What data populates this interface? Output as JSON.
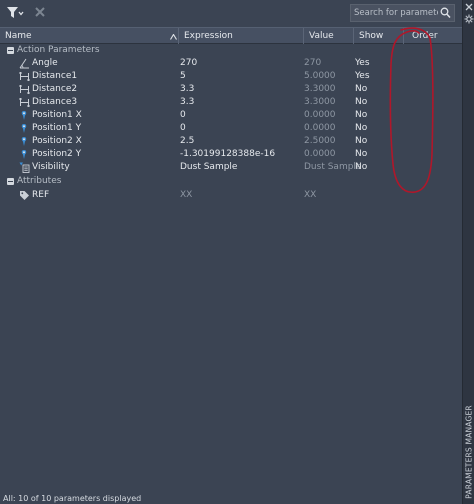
{
  "toolbar": {
    "filter_icon": "filter-icon",
    "clear_icon": "clear-filter-icon",
    "search_placeholder": "Search for parameter"
  },
  "columns": {
    "name": "Name",
    "expression": "Expression",
    "value": "Value",
    "show": "Show",
    "order": "Order"
  },
  "groups": {
    "action": {
      "label": "Action Parameters",
      "expanded": true
    },
    "attributes": {
      "label": "Attributes",
      "expanded": true
    }
  },
  "parameters": [
    {
      "name": "Angle",
      "icon": "angle-icon",
      "expression": "270",
      "value": "270",
      "show": "Yes"
    },
    {
      "name": "Distance1",
      "icon": "distance-icon",
      "expression": "5",
      "value": "5.0000",
      "show": "Yes"
    },
    {
      "name": "Distance2",
      "icon": "distance-icon",
      "expression": "3.3",
      "value": "3.3000",
      "show": "No"
    },
    {
      "name": "Distance3",
      "icon": "distance-icon",
      "expression": "3.3",
      "value": "3.3000",
      "show": "No"
    },
    {
      "name": "Position1 X",
      "icon": "position-icon",
      "expression": "0",
      "value": "0.0000",
      "show": "No"
    },
    {
      "name": "Position1 Y",
      "icon": "position-icon",
      "expression": "0",
      "value": "0.0000",
      "show": "No"
    },
    {
      "name": "Position2 X",
      "icon": "position-icon",
      "expression": "2.5",
      "value": "2.5000",
      "show": "No"
    },
    {
      "name": "Position2 Y",
      "icon": "position-icon",
      "expression": "-1.30199128388e-16",
      "value": "0.0000",
      "show": "No"
    },
    {
      "name": "Visibility",
      "icon": "visibility-icon",
      "expression": "Dust Sample",
      "value": "Dust Sample",
      "show": "No"
    }
  ],
  "attributes": [
    {
      "name": "REF",
      "icon": "tag-icon",
      "expression": "XX",
      "value": "XX",
      "show": ""
    }
  ],
  "status": "All: 10 of 10 parameters displayed",
  "side_panel": {
    "label": "PARAMETERS MANAGER",
    "close_icon": "close-icon",
    "settings_icon": "settings-icon"
  },
  "colors": {
    "background": "#3b4453",
    "header": "#465062",
    "annotation": "#b0172a"
  }
}
